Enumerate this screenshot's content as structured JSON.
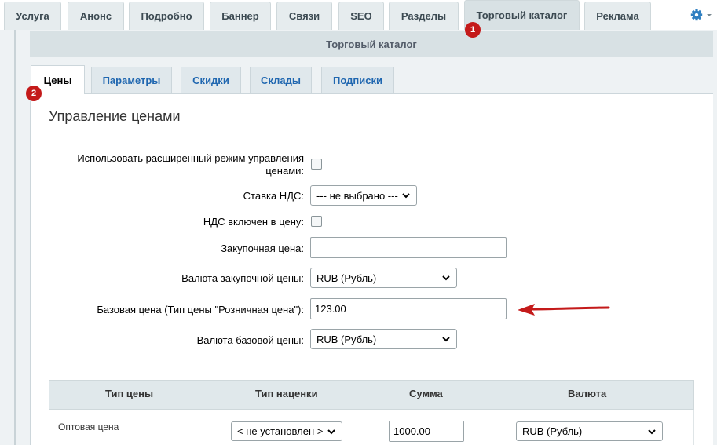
{
  "top_tabs": [
    {
      "label": "Услуга"
    },
    {
      "label": "Анонс"
    },
    {
      "label": "Подробно"
    },
    {
      "label": "Баннер"
    },
    {
      "label": "Связи"
    },
    {
      "label": "SEO"
    },
    {
      "label": "Разделы"
    },
    {
      "label": "Торговый каталог"
    },
    {
      "label": "Реклама"
    }
  ],
  "active_top_tab": "Торговый каталог",
  "section_title": "Торговый каталог",
  "sub_tabs": [
    {
      "label": "Цены"
    },
    {
      "label": "Параметры"
    },
    {
      "label": "Скидки"
    },
    {
      "label": "Склады"
    },
    {
      "label": "Подписки"
    }
  ],
  "active_sub_tab": "Цены",
  "badges": {
    "one": "1",
    "two": "2"
  },
  "price_section": {
    "title": "Управление ценами",
    "extended_mode_label_1": "Использовать расширенный режим управления",
    "extended_mode_label_2": "ценами:",
    "vat_rate_label": "Ставка НДС:",
    "vat_rate_value": "--- не выбрано ---",
    "vat_included_label": "НДС включен в цену:",
    "purchase_price_label": "Закупочная цена:",
    "purchase_price_value": "",
    "purchase_currency_label": "Валюта закупочной цены:",
    "purchase_currency_value": "RUB (Рубль)",
    "base_price_label": "Базовая цена (Тип цены \"Розничная цена\"):",
    "base_price_value": "123.00",
    "base_currency_label": "Валюта базовой цены:",
    "base_currency_value": "RUB (Рубль)"
  },
  "price_table": {
    "headers": [
      "Тип цены",
      "Тип наценки",
      "Сумма",
      "Валюта"
    ],
    "rows": [
      {
        "price_type": "Оптовая цена",
        "markup_type": "< не установлен >",
        "amount": "1000.00",
        "currency": "RUB (Рубль)"
      }
    ]
  },
  "colors": {
    "badge": "#c41a1a",
    "arrow": "#c41a1a",
    "tab_link": "#2067b0",
    "header_bg": "#d8e1e4"
  },
  "icons": {
    "settings": "gear-icon",
    "select_arrow": "chevron-down-icon",
    "annotation": "red-arrow-icon"
  }
}
